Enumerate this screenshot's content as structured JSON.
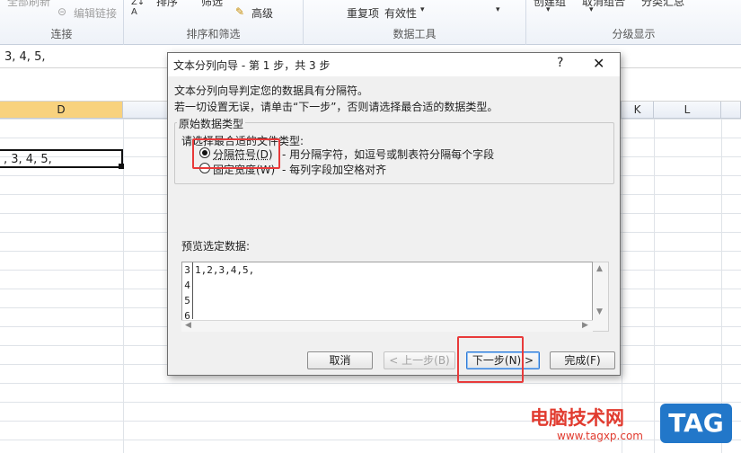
{
  "ribbon": {
    "top_cut_text": "全部刷新",
    "edit_links": "编辑链接",
    "group_connections": "连接",
    "sort_filter": {
      "sort_label": "排序",
      "filter_label": "筛选",
      "advanced": "高级",
      "group_label": "排序和筛选"
    },
    "data_tools": {
      "remove_duplicates": "重复项",
      "validation": "有效性",
      "group_label": "数据工具"
    },
    "outline": {
      "create_group": "创建组",
      "ungroup": "取消组合",
      "subtotal": "分类汇总",
      "group_label": "分级显示"
    }
  },
  "formula_bar": {
    "value": "3, 4, 5,"
  },
  "sheet": {
    "columns": [
      "D",
      "K",
      "L"
    ],
    "active_cell_text": ", 3, 4, 5,"
  },
  "dialog": {
    "title": "文本分列向导 - 第 1 步，共 3 步",
    "help": "?",
    "close": "✕",
    "intro_line1": "文本分列向导判定您的数据具有分隔符。",
    "intro_line2": "若一切设置无误，请单击“下一步”，否则请选择最合适的数据类型。",
    "section_title": "原始数据类型",
    "choose_label": "请选择最合适的文件类型:",
    "option_delimited": "分隔符号(D)",
    "option_delimited_desc": "- 用分隔字符，如逗号或制表符分隔每个字段",
    "option_fixed": "固定宽度(W)",
    "option_fixed_desc": "- 每列字段加空格对齐",
    "selected_option": "delimited",
    "preview_label": "预览选定数据:",
    "preview_rows": [
      {
        "num": "3",
        "text": "1,2,3,4,5,"
      },
      {
        "num": "4",
        "text": ""
      },
      {
        "num": "5",
        "text": ""
      },
      {
        "num": "6",
        "text": ""
      }
    ],
    "buttons": {
      "cancel": "取消",
      "back": "< 上一步(B)",
      "next": "下一步(N) >",
      "finish": "完成(F)"
    }
  },
  "watermark": {
    "text": "电脑技术网",
    "url": "www.tagxp.com",
    "tag": "TAG"
  },
  "colors": {
    "highlight_red": "#e83a3a",
    "active_column": "#f8d27e",
    "primary_button_border": "#2e7ad6",
    "tag_blue": "#2277c9"
  }
}
